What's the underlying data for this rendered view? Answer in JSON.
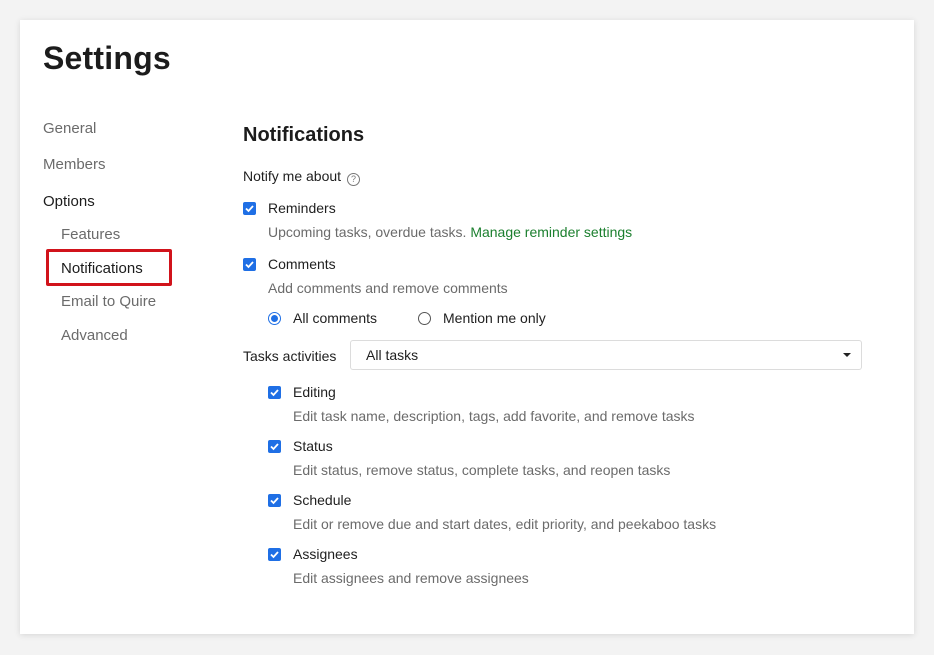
{
  "page_title": "Settings",
  "sidebar": {
    "items": [
      {
        "label": "General"
      },
      {
        "label": "Members"
      },
      {
        "label": "Options"
      },
      {
        "label": "Features"
      },
      {
        "label": "Notifications"
      },
      {
        "label": "Email to Quire"
      },
      {
        "label": "Advanced"
      }
    ]
  },
  "section": {
    "title": "Notifications",
    "notify_label": "Notify me about",
    "help_icon": "?",
    "reminders": {
      "label": "Reminders",
      "checked": true,
      "desc": "Upcoming tasks, overdue tasks. ",
      "link": "Manage reminder settings"
    },
    "comments": {
      "label": "Comments",
      "checked": true,
      "desc": "Add comments and remove comments",
      "options": [
        {
          "label": "All comments",
          "selected": true
        },
        {
          "label": "Mention me only",
          "selected": false
        }
      ]
    },
    "tasks_activities": {
      "label": "Tasks activities",
      "selected": "All tasks",
      "items": [
        {
          "label": "Editing",
          "checked": true,
          "desc": "Edit task name, description, tags, add favorite, and remove tasks"
        },
        {
          "label": "Status",
          "checked": true,
          "desc": "Edit status, remove status, complete tasks, and reopen tasks"
        },
        {
          "label": "Schedule",
          "checked": true,
          "desc": "Edit or remove due and start dates, edit priority, and peekaboo tasks"
        },
        {
          "label": "Assignees",
          "checked": true,
          "desc": "Edit assignees and remove assignees"
        }
      ]
    }
  },
  "colors": {
    "accent": "#1f6fe5",
    "link": "#1b7f2e",
    "highlight": "#d1131b"
  }
}
